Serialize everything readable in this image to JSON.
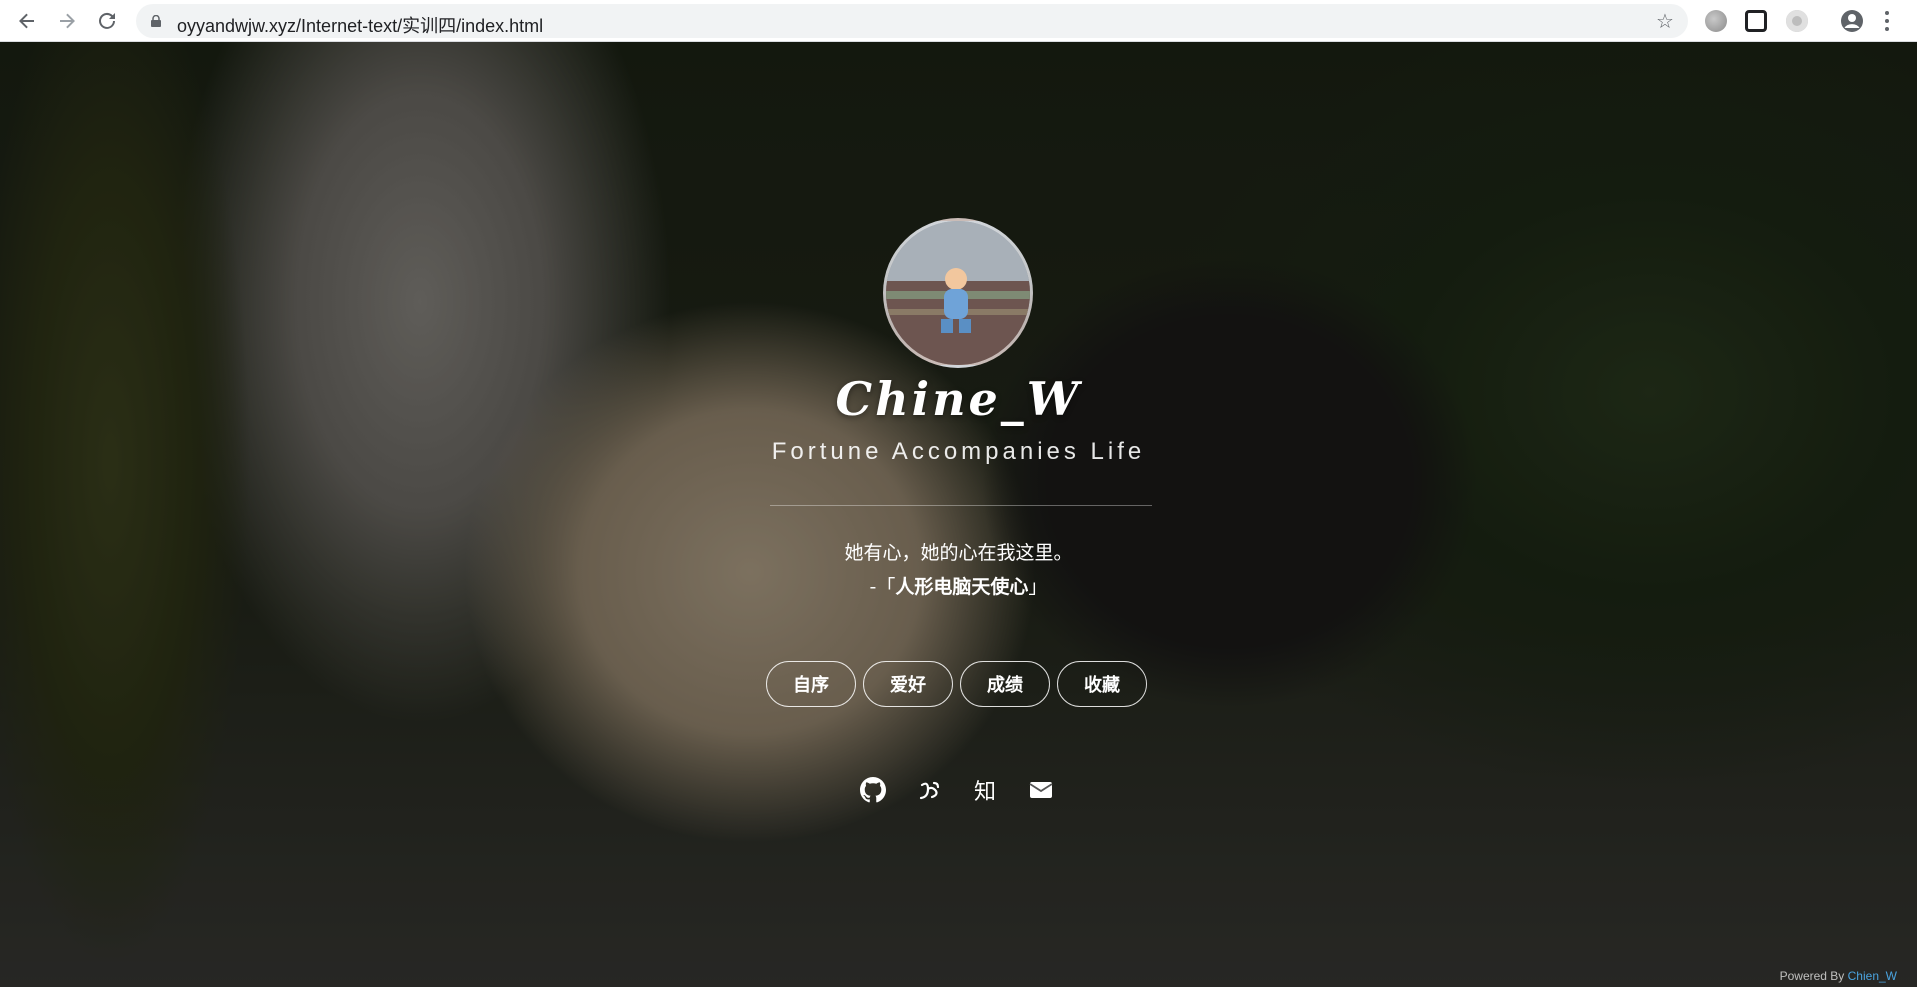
{
  "browser": {
    "url": "oyyandwjw.xyz/Internet-text/实训四/index.html"
  },
  "profile": {
    "name": "Chine_W",
    "tagline": "Fortune Accompanies Life",
    "quote": "她有心，她的心在我这里。",
    "quote_prefix": "-「",
    "quote_source": "人形电脑天使心",
    "quote_suffix": "」"
  },
  "nav": {
    "items": [
      {
        "label": "自序"
      },
      {
        "label": "爱好"
      },
      {
        "label": "成绩"
      },
      {
        "label": "收藏"
      }
    ]
  },
  "social": {
    "zhihu_label": "知"
  },
  "footer": {
    "powered_by": "Powered By",
    "author": "Chien_W"
  },
  "icons": [
    "back-icon",
    "forward-icon",
    "reload-icon",
    "lock-icon",
    "star-icon",
    "extension-icon",
    "profile-icon",
    "menu-icon",
    "github-icon",
    "weibo-icon",
    "zhihu-icon",
    "mail-icon"
  ]
}
